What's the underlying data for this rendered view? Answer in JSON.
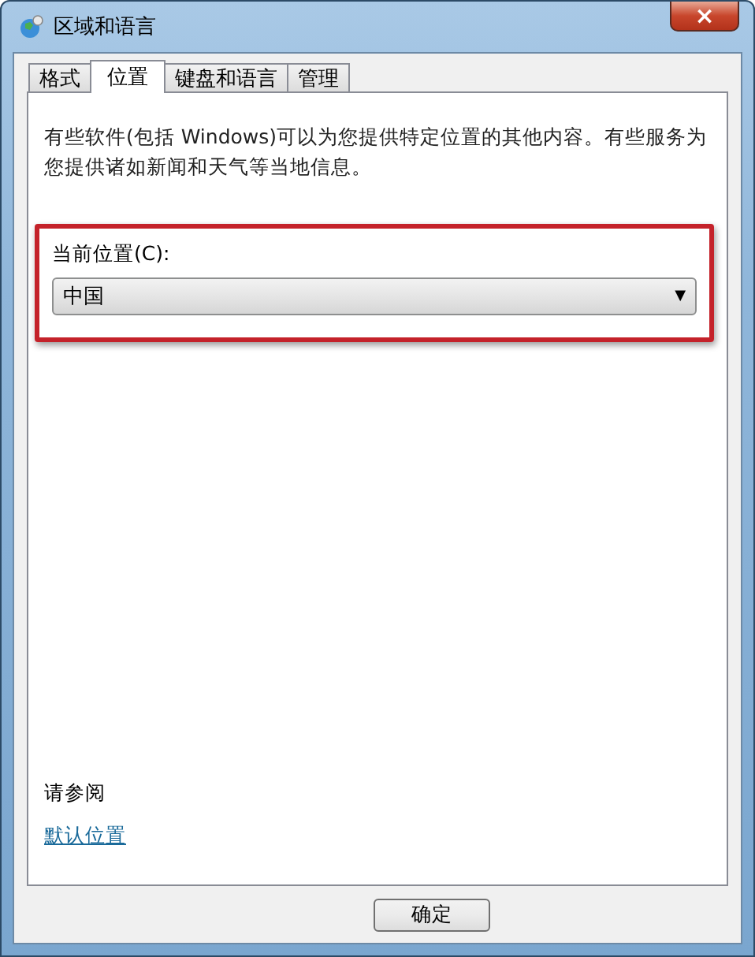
{
  "window": {
    "title": "区域和语言",
    "close": "×"
  },
  "tabs": [
    {
      "label": "格式",
      "selected": false
    },
    {
      "label": "位置",
      "selected": true
    },
    {
      "label": "键盘和语言",
      "selected": false
    },
    {
      "label": "管理",
      "selected": false
    }
  ],
  "description": "有些软件(包括 Windows)可以为您提供特定位置的其他内容。有些服务为您提供诸如新闻和天气等当地信息。",
  "location": {
    "label": "当前位置(C):",
    "value": "中国",
    "caret": "▼"
  },
  "see_also": {
    "heading": "请参阅",
    "links": [
      "默认位置"
    ]
  },
  "buttons": [
    "确定"
  ]
}
